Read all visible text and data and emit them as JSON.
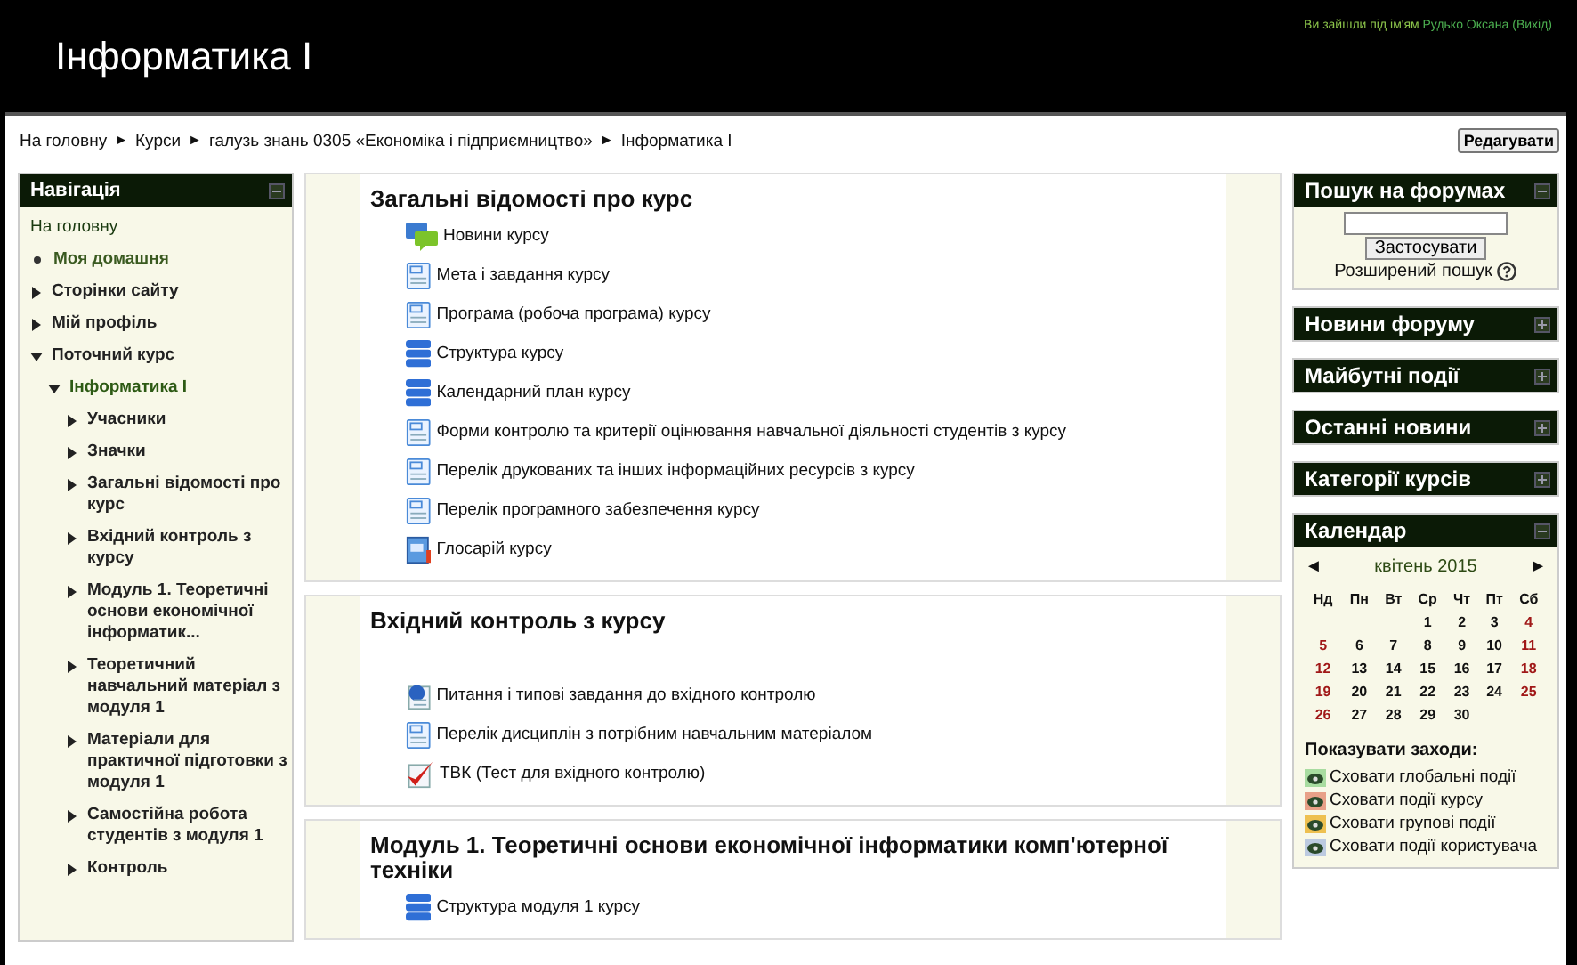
{
  "header": {
    "title": "Інформатика І",
    "login_prefix": "Ви зайшли під ім'ям",
    "login_user": "Рудько Оксана",
    "logout": "(Вихід)"
  },
  "breadcrumb": [
    "На головну",
    "Курси",
    "галузь знань 0305 «Економіка і підприємництво»",
    "Інформатика І"
  ],
  "breadcrumb_separator": "►",
  "edit_button": "Редагувати",
  "navigation": {
    "title": "Навігація",
    "expanded": true,
    "items": [
      {
        "label": "На головну",
        "kind": "home"
      },
      {
        "label": "Моя домашня",
        "kind": "leaf"
      },
      {
        "label": "Сторінки сайту",
        "kind": "branch",
        "expanded": false
      },
      {
        "label": "Мій профіль",
        "kind": "branch",
        "expanded": false
      },
      {
        "label": "Поточний курс",
        "kind": "branch",
        "expanded": true,
        "children": [
          {
            "label": "Інформатика І",
            "kind": "branch",
            "expanded": true,
            "current": true,
            "children": [
              {
                "label": "Учасники",
                "kind": "branch",
                "expanded": false
              },
              {
                "label": "Значки",
                "kind": "branch",
                "expanded": false
              },
              {
                "label": "Загальні відомості про курс",
                "kind": "branch",
                "expanded": false
              },
              {
                "label": "Вхідний контроль з курсу",
                "kind": "branch",
                "expanded": false
              },
              {
                "label": "Модуль 1. Теоретичні основи економічної інформатик...",
                "kind": "branch",
                "expanded": false
              },
              {
                "label": "Теоретичний навчальний матеріал з модуля 1",
                "kind": "branch",
                "expanded": false
              },
              {
                "label": "Матеріали для практичної підготовки з модуля 1",
                "kind": "branch",
                "expanded": false
              },
              {
                "label": "Самостійна робота студентів з модуля 1",
                "kind": "branch",
                "expanded": false
              },
              {
                "label": "Контроль",
                "kind": "branch",
                "expanded": false
              }
            ]
          }
        ]
      }
    ]
  },
  "sections": [
    {
      "title": "Загальні відомості про курс",
      "items": [
        {
          "label": "Новини курсу",
          "kind": "forum"
        },
        {
          "label": "Мета і завдання курсу",
          "kind": "page"
        },
        {
          "label": "Програма (робоча програма) курсу",
          "kind": "page"
        },
        {
          "label": "Структура курсу",
          "kind": "stack"
        },
        {
          "label": "Календарний план курсу",
          "kind": "stack"
        },
        {
          "label": "Форми контролю та критерії оцінювання навчальної діяльності студентів з курсу",
          "kind": "page"
        },
        {
          "label": "Перелік друкованих та інших інформаційних ресурсів з курсу",
          "kind": "page"
        },
        {
          "label": "Перелік програмного забезпечення курсу",
          "kind": "page"
        },
        {
          "label": "Глосарій курсу",
          "kind": "glossary"
        }
      ]
    },
    {
      "title": "Вхідний контроль з курсу",
      "items": [
        {
          "label": "Питання і типові завдання до вхідного контролю",
          "kind": "document"
        },
        {
          "label": "Перелік дисциплін з потрібним навчальним матеріалом",
          "kind": "page"
        },
        {
          "label": "ТВК (Тест для вхідного контролю)",
          "kind": "quiz"
        }
      ]
    },
    {
      "title": "Модуль 1. Теоретичні основи економічної інформатики комп'ютерної техніки",
      "items": [
        {
          "label": "Структура модуля 1 курсу",
          "kind": "stack"
        }
      ]
    }
  ],
  "search_block": {
    "title": "Пошук на форумах",
    "expanded": true,
    "button": "Застосувати",
    "advanced": "Розширений пошук"
  },
  "collapsed_blocks": [
    {
      "title": "Новини форуму",
      "expanded": false
    },
    {
      "title": "Майбутні події",
      "expanded": false
    },
    {
      "title": "Останні новини",
      "expanded": false
    },
    {
      "title": "Категорії курсів",
      "expanded": false
    }
  ],
  "calendar": {
    "title": "Календар",
    "expanded": true,
    "prev": "◄",
    "next": "►",
    "month": "квітень 2015",
    "weekdays": [
      "Нд",
      "Пн",
      "Вт",
      "Ср",
      "Чт",
      "Пт",
      "Сб"
    ],
    "weeks": [
      {
        "kind": "first",
        "days": [
          "1",
          "2",
          "3",
          "4"
        ]
      },
      {
        "kind": "full",
        "days": [
          "5",
          "6",
          "7",
          "8",
          "9",
          "10",
          "11"
        ]
      },
      {
        "kind": "full",
        "days": [
          "12",
          "13",
          "14",
          "15",
          "16",
          "17",
          "18"
        ]
      },
      {
        "kind": "full",
        "days": [
          "19",
          "20",
          "21",
          "22",
          "23",
          "24",
          "25"
        ]
      },
      {
        "kind": "last",
        "days": [
          "26",
          "27",
          "28",
          "29",
          "30"
        ]
      }
    ],
    "events_title": "Показувати заходи:",
    "event_keys": [
      {
        "label": "Сховати глобальні події",
        "color": "#a8dca0"
      },
      {
        "label": "Сховати події курсу",
        "color": "#e8a088"
      },
      {
        "label": "Сховати групові події",
        "color": "#eec050"
      },
      {
        "label": "Сховати події користувача",
        "color": "#bccae0"
      }
    ]
  }
}
